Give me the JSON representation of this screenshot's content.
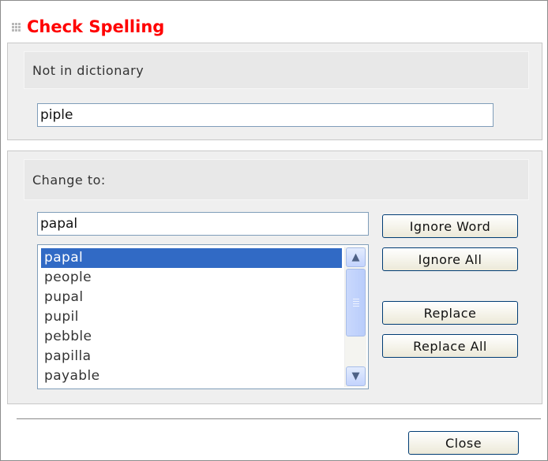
{
  "dialog": {
    "title": "Check Spelling"
  },
  "not_in_dictionary": {
    "label": "Not in dictionary",
    "value": "piple"
  },
  "change_to": {
    "label": "Change to:",
    "value": "papal",
    "suggestions": [
      "papal",
      "people",
      "pupal",
      "pupil",
      "pebble",
      "papilla",
      "payable"
    ],
    "selected_index": 0
  },
  "buttons": {
    "ignore_word": "Ignore Word",
    "ignore_all": "Ignore All",
    "replace": "Replace",
    "replace_all": "Replace All",
    "close": "Close"
  },
  "icons": {
    "title_grip": "grip-dots-icon",
    "scroll_up": "chevron-up-icon",
    "scroll_down": "chevron-down-icon"
  },
  "colors": {
    "title": "#ff0000",
    "selection": "#316ac5",
    "panel": "#efefef"
  }
}
